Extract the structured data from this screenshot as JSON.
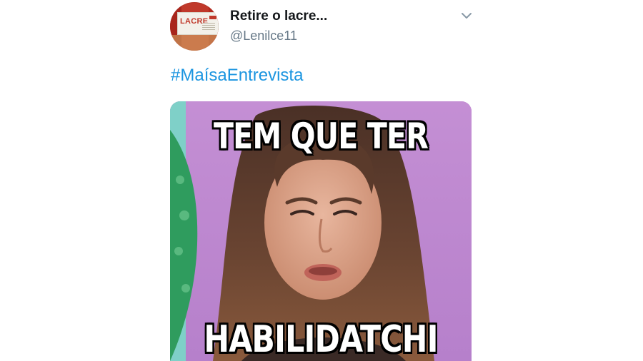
{
  "tweet": {
    "display_name": "Retire o lacre...",
    "handle": "@Lenilce11",
    "hashtag": "#MaísaEntrevista",
    "avatar": {
      "seal_text": "LACRE"
    },
    "menu_icon": "chevron-down-icon"
  },
  "media": {
    "caption_top": "TEM QUE TER",
    "caption_bottom": "HABILIDATCHI"
  },
  "colors": {
    "link": "#1b95e0",
    "handle": "#657786",
    "name": "#14171a"
  }
}
